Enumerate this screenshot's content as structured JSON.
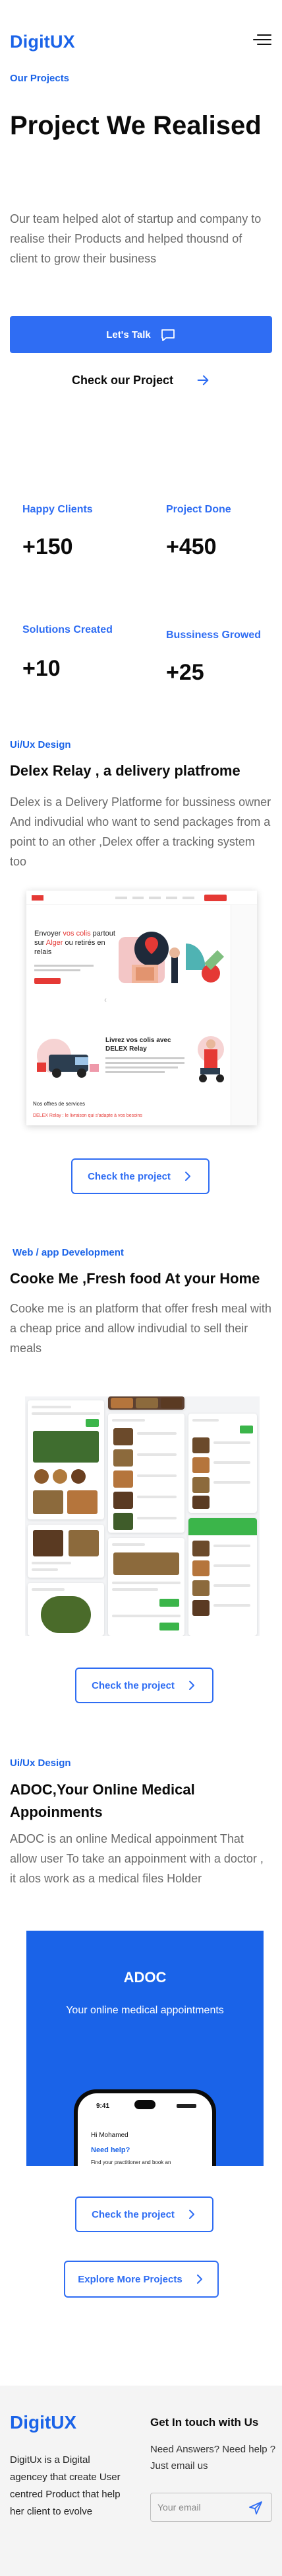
{
  "header": {
    "logo": "DigitUX",
    "menu_icon": "hamburger-menu-icon"
  },
  "hero": {
    "eyebrow": "Our Projects",
    "title": "Project We Realised",
    "description": "Our team helped alot of startup and company to realise their Products and helped thousnd of client to grow their business",
    "talk_button": "Let's Talk",
    "talk_icon": "chat-message-icon",
    "check_project": "Check our Project",
    "check_icon": "arrow-right-icon"
  },
  "stats": [
    {
      "label": "Happy Clients",
      "value": "+150"
    },
    {
      "label": "Project Done",
      "value": "+450"
    },
    {
      "label": "Solutions Created",
      "value": "+10"
    },
    {
      "label": "Bussiness Growed",
      "value": "+25"
    }
  ],
  "projects": [
    {
      "tag": "Ui/Ux Design",
      "title": "Delex Relay , a delivery platfrome",
      "description": "Delex is a Delivery Platforme for bussiness owner And indivudial who want to send packages from a point to an other ,Delex offer a tracking system too",
      "button": "Check the project",
      "mockup": {
        "headline_prefix": "Envoyer ",
        "headline_red1": "vos colis",
        "headline_mid": " partout sur ",
        "headline_red2": "Alger",
        "headline_suffix": " ou retirés en relais",
        "section_title": "Livrez vos colis avec DELEX Relay",
        "services_title": "Nos offres de services",
        "services_subtitle": "DELEX Relay : le livraison qui s'adapte à vos besoins"
      }
    },
    {
      "tag": "Web / app Development",
      "title": "Cooke Me ,Fresh food At your Home",
      "description": "Cooke me is an platform that offer fresh meal with a cheap price and allow indivudial to sell their meals",
      "button": "Check the project"
    },
    {
      "tag": "Ui/Ux Design",
      "title": "ADOC,Your Online Medical Appoinments",
      "description": "ADOC is an online Medical appoinment That allow user To take an appoinment with a doctor , it alos work as a medical files Holder",
      "button": "Check the project",
      "mockup": {
        "title": "ADOC",
        "subtitle": "Your online medical appointments",
        "time": "9:41",
        "greeting": "Hi Mohamed",
        "need_help": "Need help?",
        "find_text": "Find your practitioner and book an"
      }
    }
  ],
  "explore_button": "Explore More Projects",
  "footer": {
    "logo": "DigitUX",
    "about": "DigitUx is a Digital agencey that create User centred Product that help her client to evolve",
    "contact_title": "Get In touch with Us",
    "contact_text": "Need Answers? Need help ? Just email us",
    "email_placeholder": "Your email",
    "send_icon": "send-paper-plane-icon"
  },
  "colors": {
    "brand_blue": "#1a63e8",
    "button_blue": "#2f6df3",
    "delex_red": "#e53935",
    "cookeme_green": "#3bb54a"
  }
}
